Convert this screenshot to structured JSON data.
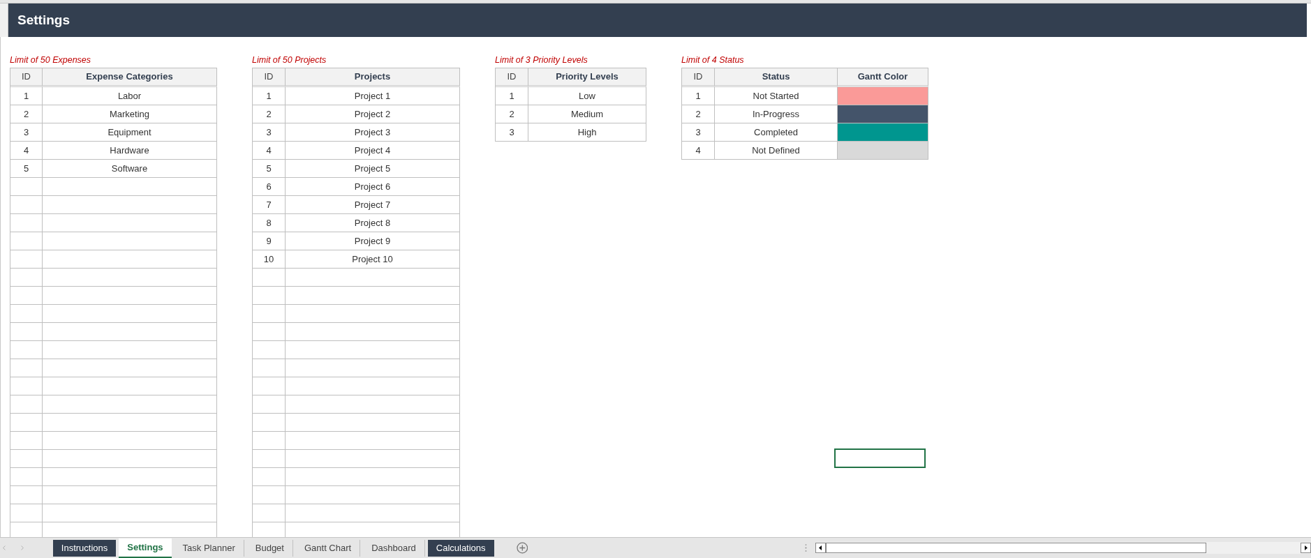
{
  "header": {
    "title": "Settings"
  },
  "tables": [
    {
      "note": "Limit of 50 Expenses",
      "columns": [
        "ID",
        "Expense Categories"
      ],
      "rows": [
        [
          "1",
          "Labor"
        ],
        [
          "2",
          "Marketing"
        ],
        [
          "3",
          "Equipment"
        ],
        [
          "4",
          "Hardware"
        ],
        [
          "5",
          "Software"
        ]
      ]
    },
    {
      "note": "Limit of 50 Projects",
      "columns": [
        "ID",
        "Projects"
      ],
      "rows": [
        [
          "1",
          "Project 1"
        ],
        [
          "2",
          "Project 2"
        ],
        [
          "3",
          "Project 3"
        ],
        [
          "4",
          "Project 4"
        ],
        [
          "5",
          "Project 5"
        ],
        [
          "6",
          "Project 6"
        ],
        [
          "7",
          "Project 7"
        ],
        [
          "8",
          "Project 8"
        ],
        [
          "9",
          "Project 9"
        ],
        [
          "10",
          "Project 10"
        ]
      ]
    },
    {
      "note": "Limit of 3 Priority Levels",
      "columns": [
        "ID",
        "Priority Levels"
      ],
      "rows": [
        [
          "1",
          "Low"
        ],
        [
          "2",
          "Medium"
        ],
        [
          "3",
          "High"
        ]
      ]
    },
    {
      "note": "Limit of 4 Status",
      "columns": [
        "ID",
        "Status",
        "Gantt Color"
      ],
      "rows": [
        [
          "1",
          "Not Started"
        ],
        [
          "2",
          "In-Progress"
        ],
        [
          "3",
          "Completed"
        ],
        [
          "4",
          "Not Defined"
        ]
      ],
      "swatches": [
        {
          "color": "#fa9a98"
        },
        {
          "color": "#44546a"
        },
        {
          "color": "#00968f"
        },
        {
          "color": "#d9d9d9"
        }
      ]
    }
  ],
  "sheet_tabs": [
    {
      "label": "Instructions",
      "selected": false,
      "color": "#333f50"
    },
    {
      "label": "Settings",
      "selected": true
    },
    {
      "label": "Task Planner",
      "selected": false
    },
    {
      "label": "Budget",
      "selected": false
    },
    {
      "label": "Gantt Chart",
      "selected": false
    },
    {
      "label": "Dashboard",
      "selected": false
    },
    {
      "label": "Calculations",
      "selected": false,
      "color": "#333f50"
    }
  ]
}
